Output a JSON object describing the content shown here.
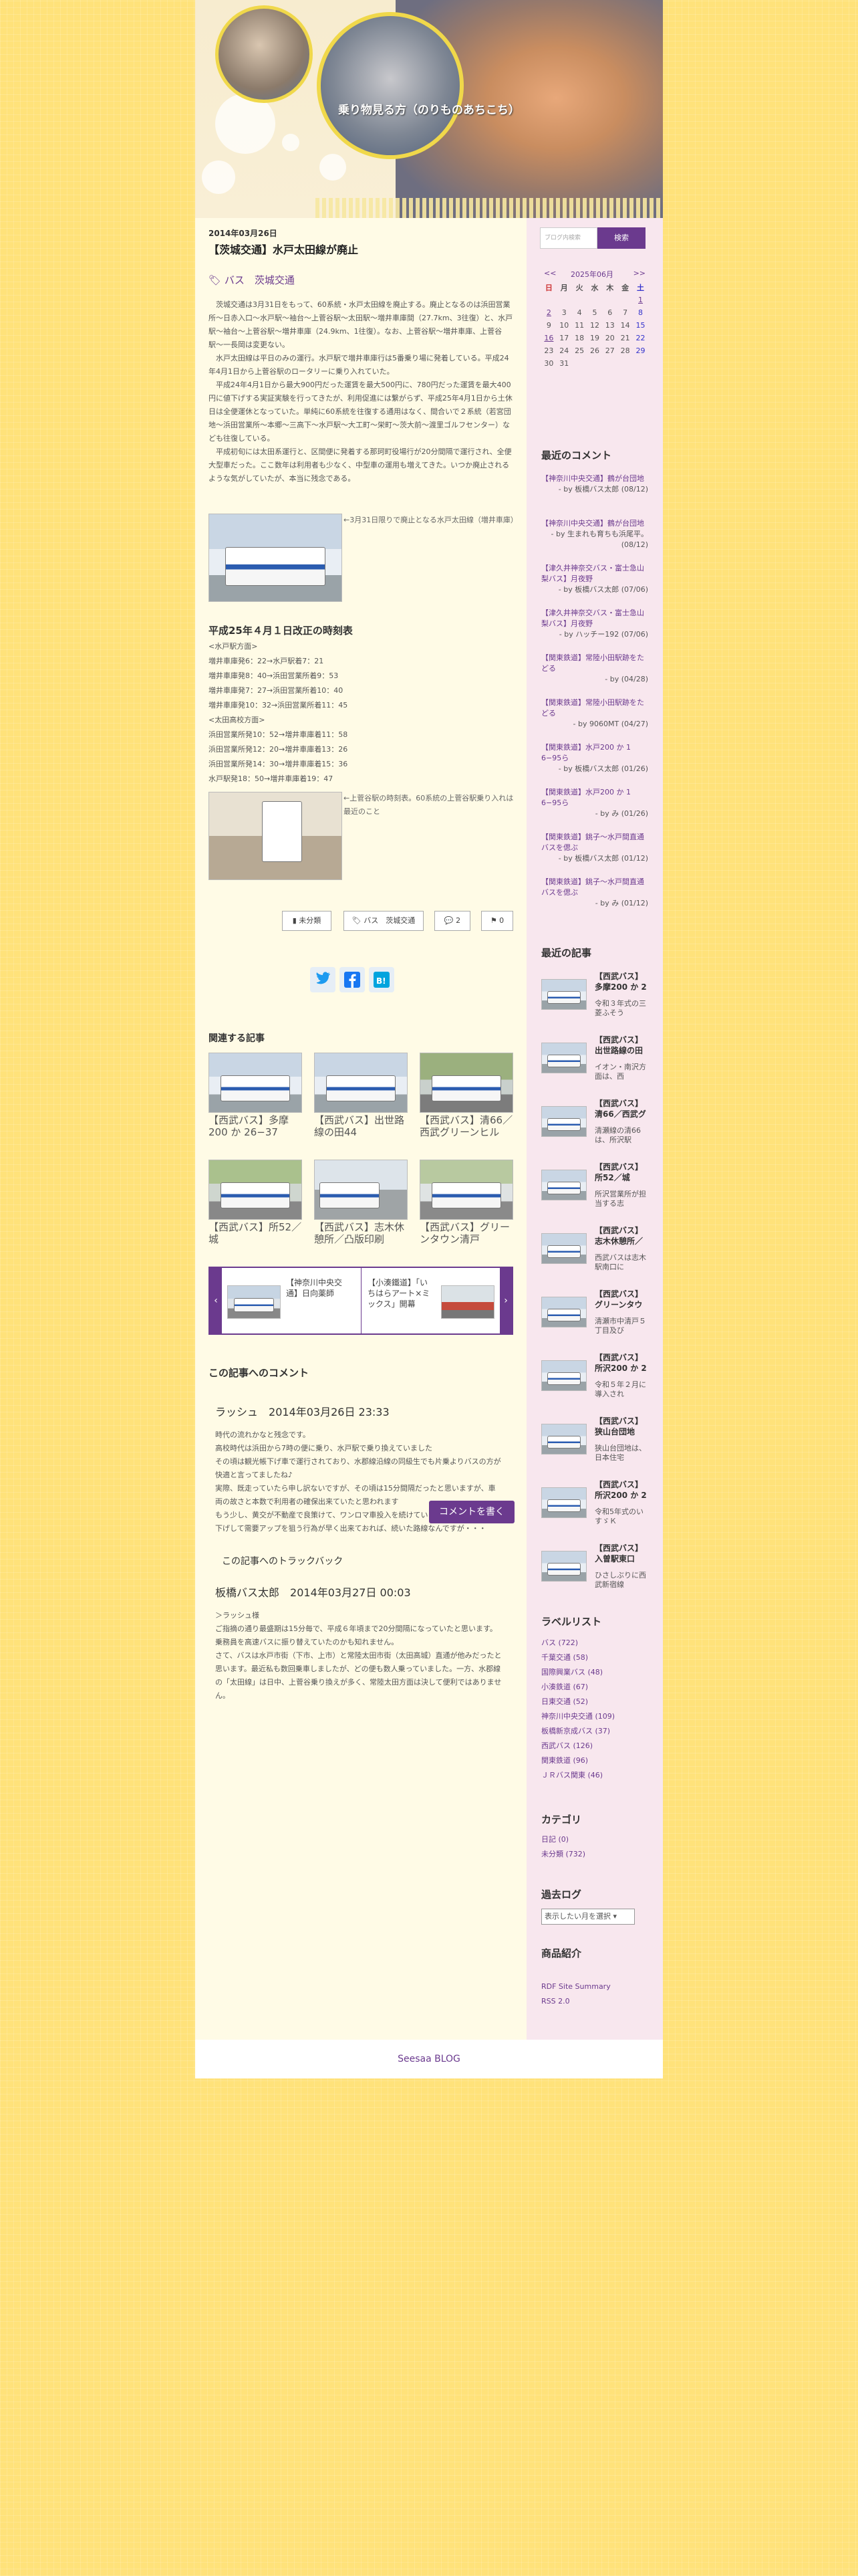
{
  "blog": {
    "title": "乗り物見る方（のりものあちこち）"
  },
  "post": {
    "date": "2014年03月26日",
    "title": "【茨城交通】水戸太田線が廃止",
    "tags": "バス　茨城交通",
    "body": [
      "　茨城交通は3月31日をもって、60系統・水戸太田線を廃止する。廃止となるのは浜田営業所〜日赤入口〜水戸駅〜袖台〜上菅谷駅〜太田駅〜増井車庫間（27.7km、3往復）と、水戸駅〜袖台〜上菅谷駅〜増井車庫（24.9km、1往復）。なお、上菅谷駅〜増井車庫、上菅谷駅〜一長岡は変更ない。",
      "　水戸太田線は平日のみの運行。水戸駅で増井車庫行は5番乗り場に発着している。平成24年4月1日から上菅谷駅のロータリーに乗り入れていた。",
      "　平成24年4月1日から最大900円だった運賃を最大500円に、780円だった運賃を最大400円に値下げする実証実験を行ってきたが、利用促進には繋がらず、平成25年4月1日から土休日は全便運休となっていた。単純に60系統を往復する通用はなく、間合いで２系統（若宮団地〜浜田営業所〜本郷〜三高下〜水戸駅〜大工町〜栄町〜茨大前〜渡里ゴルフセンター）なども往復している。",
      "　平成初旬には太田系運行と、区間便に発着する那珂町役場行が20分間隔で運行され、全便大型車だった。ここ数年は利用者も少なく、中型車の運用も増えてきた。いつか廃止されるような気がしていたが、本当に残念である。"
    ],
    "caption1": "←3月31日限りで廃止となる水戸太田線（増井車庫）",
    "schedule_title": "平成25年４月１日改正の時刻表",
    "schedule": "<水戸駅方面>\n増井車庫発6：22→水戸駅着7：21\n増井車庫発8：40→浜田営業所着9：53\n増井車庫発7：27→浜田営業所着10：40\n増井車庫発10：32→浜田営業所着11：45\n<太田高校方面>\n浜田営業所発10：52→増井車庫着11：58\n浜田営業所発12：20→増井車庫着13：26\n浜田営業所発14：30→増井車庫着15：36\n水戸駅発18：50→増井車庫着19：47",
    "caption2": "←上菅谷駅の時刻表。60系統の上菅谷駅乗り入れは最近のこと",
    "btn_category": "未分類",
    "btn_tags": "バス　茨城交通",
    "btn_comments": "2",
    "btn_trackback": "0"
  },
  "related": {
    "heading": "関連する記事",
    "items": [
      "【西武バス】多摩200 か 26−37",
      "【西武バス】出世路線の田44",
      "【西武バス】清66／西武グリーンヒル",
      "【西武バス】所52／城",
      "【西武バス】志木休憩所／凸版印刷",
      "【西武バス】グリーンタウン清戸"
    ],
    "carousel": [
      "【神奈川中央交通】日向薬師",
      "【小湊鐵道】「いちはらアート×ミックス」開幕"
    ]
  },
  "comments": {
    "heading": "この記事へのコメント",
    "list": [
      {
        "name": "ラッシュ",
        "date": "2014年03月26日 23:33",
        "text": "時代の流れかなと残念です。\n高校時代は浜田から7時の便に乗り、水戸駅で乗り換えていました\nその頃は観光帳下げ車で運行されており、水郡線沿線の同級生でも片乗よりバスの方が快適と言ってましたね♪\n実際、既走っていたら申し訳ないですが、その頃は15分間隔だったと思いますが、車両の故さと本数で利用者の確保出来ていたと思われます\nもう少し、黄交が不動産で良策けて、ワンロマ車投入を続けていられる時程のなが、値下げして需要アップを狙う行為が早く出来ておれば、続いた路線なんですが・・・"
      },
      {
        "name": "板橋バス太郎",
        "date": "2014年03月27日 00:03",
        "text": "＞ラッシュ様\nご指摘の通り最盛期は15分毎で、平成６年頃まで20分間隔になっていたと思います。乗務員を高速バスに振り替えていたのかも知れません。\nさて、バスは水戸市街（下市、上市）と常陸太田市街（太田高城）直通が他みだったと思います。最近私も数回乗車しましたが、どの便も数人乗っていました。一方、水郡線の「太田線」は日中、上菅谷乗り換えが多く、常陸太田方面は決して便利ではありません。"
      }
    ],
    "write_button": "コメントを書く",
    "trackback_heading": "この記事へのトラックバック"
  },
  "sidebar": {
    "search_placeholder": "ブログ内検索",
    "search_button": "検索",
    "calendar": {
      "prev": "<<",
      "title": "2025年06月",
      "next": ">>",
      "week": [
        "日",
        "月",
        "火",
        "水",
        "木",
        "金",
        "土"
      ],
      "rows": [
        [
          "",
          "",
          "",
          "",
          "",
          "",
          "1"
        ],
        [
          "2",
          "3",
          "4",
          "5",
          "6",
          "7",
          "8"
        ],
        [
          "9",
          "10",
          "11",
          "12",
          "13",
          "14",
          "15"
        ],
        [
          "16",
          "17",
          "18",
          "19",
          "20",
          "21",
          "22"
        ],
        [
          "23",
          "24",
          "25",
          "26",
          "27",
          "28",
          "29"
        ],
        [
          "30",
          "31",
          "",
          "",
          "",
          "",
          ""
        ]
      ]
    },
    "recent_comments_heading": "最近のコメント",
    "recent_comments": [
      {
        "link": "【神奈川中央交通】鶴が台団地",
        "by": "- by 板橋バス太郎 (08/12)"
      },
      {
        "link": "【神奈川中央交通】鶴が台団地",
        "by": "- by 生まれも育ちも浜尾平。 (08/12)"
      },
      {
        "link": "【津久井神奈交バス・富士急山梨バス】月夜野",
        "by": "- by 板橋バス太郎 (07/06)"
      },
      {
        "link": "【津久井神奈交バス・富士急山梨バス】月夜野",
        "by": "- by ハッチー192 (07/06)"
      },
      {
        "link": "【関東鉄道】常陸小田駅跡をたどる",
        "by": "- by  (04/28)"
      },
      {
        "link": "【関東鉄道】常陸小田駅跡をたどる",
        "by": "- by 9060MT (04/27)"
      },
      {
        "link": "【関東鉄道】水戸200 か 1 6−95ら",
        "by": "- by 板橋バス太郎 (01/26)"
      },
      {
        "link": "【関東鉄道】水戸200 か 1 6−95ら",
        "by": "- by み (01/26)"
      },
      {
        "link": "【関東鉄道】銚子〜水戸間直通バスを偲ぶ",
        "by": "- by 板橋バス太郎 (01/12)"
      },
      {
        "link": "【関東鉄道】銚子〜水戸間直通バスを偲ぶ",
        "by": "- by み (01/12)"
      }
    ],
    "recent_articles_heading": "最近の記事",
    "recent_articles": [
      {
        "title": "【西武バス】多摩200 か 2",
        "excerpt": "令和３年式の三菱ふそう"
      },
      {
        "title": "【西武バス】出世路線の田",
        "excerpt": "イオン・南沢方面は、西"
      },
      {
        "title": "【西武バス】清66／西武グ",
        "excerpt": "清瀬線の清66は、所沢駅"
      },
      {
        "title": "【西武バス】所52／城",
        "excerpt": "所沢営業所が担当する志"
      },
      {
        "title": "【西武バス】志木休憩所／",
        "excerpt": "西武バスは志木駅南口に"
      },
      {
        "title": "【西武バス】グリーンタウ",
        "excerpt": "清瀬市中清戸５丁目及び"
      },
      {
        "title": "【西武バス】所沢200 か 2",
        "excerpt": "令和５年２月に導入され"
      },
      {
        "title": "【西武バス】狭山台団地",
        "excerpt": "狭山台団地は、日本住宅"
      },
      {
        "title": "【西武バス】所沢200 か 2",
        "excerpt": "令和5年式のいすゞＫ"
      },
      {
        "title": "【西武バス】入曽駅東口",
        "excerpt": "ひさしぶりに西武新宿線"
      }
    ],
    "labels_heading": "ラベルリスト",
    "labels": [
      "バス (722)",
      "千葉交通 (58)",
      "国際興業バス (48)",
      "小湊鉄道 (67)",
      "日東交通 (52)",
      "神奈川中央交通 (109)",
      "板橋新京成バス (37)",
      "西武バス (126)",
      "関東鉄道 (96)",
      "ＪＲバス関東 (46)"
    ],
    "category_heading": "カテゴリ",
    "categories": [
      "日記 (0)",
      "未分類 (732)"
    ],
    "archive_heading": "過去ログ",
    "archive_select": "表示したい月を選択",
    "products_heading": "商品紹介",
    "feeds": [
      "RDF Site Summary",
      "RSS 2.0"
    ]
  },
  "footer": {
    "text": "Seesaa BLOG"
  }
}
